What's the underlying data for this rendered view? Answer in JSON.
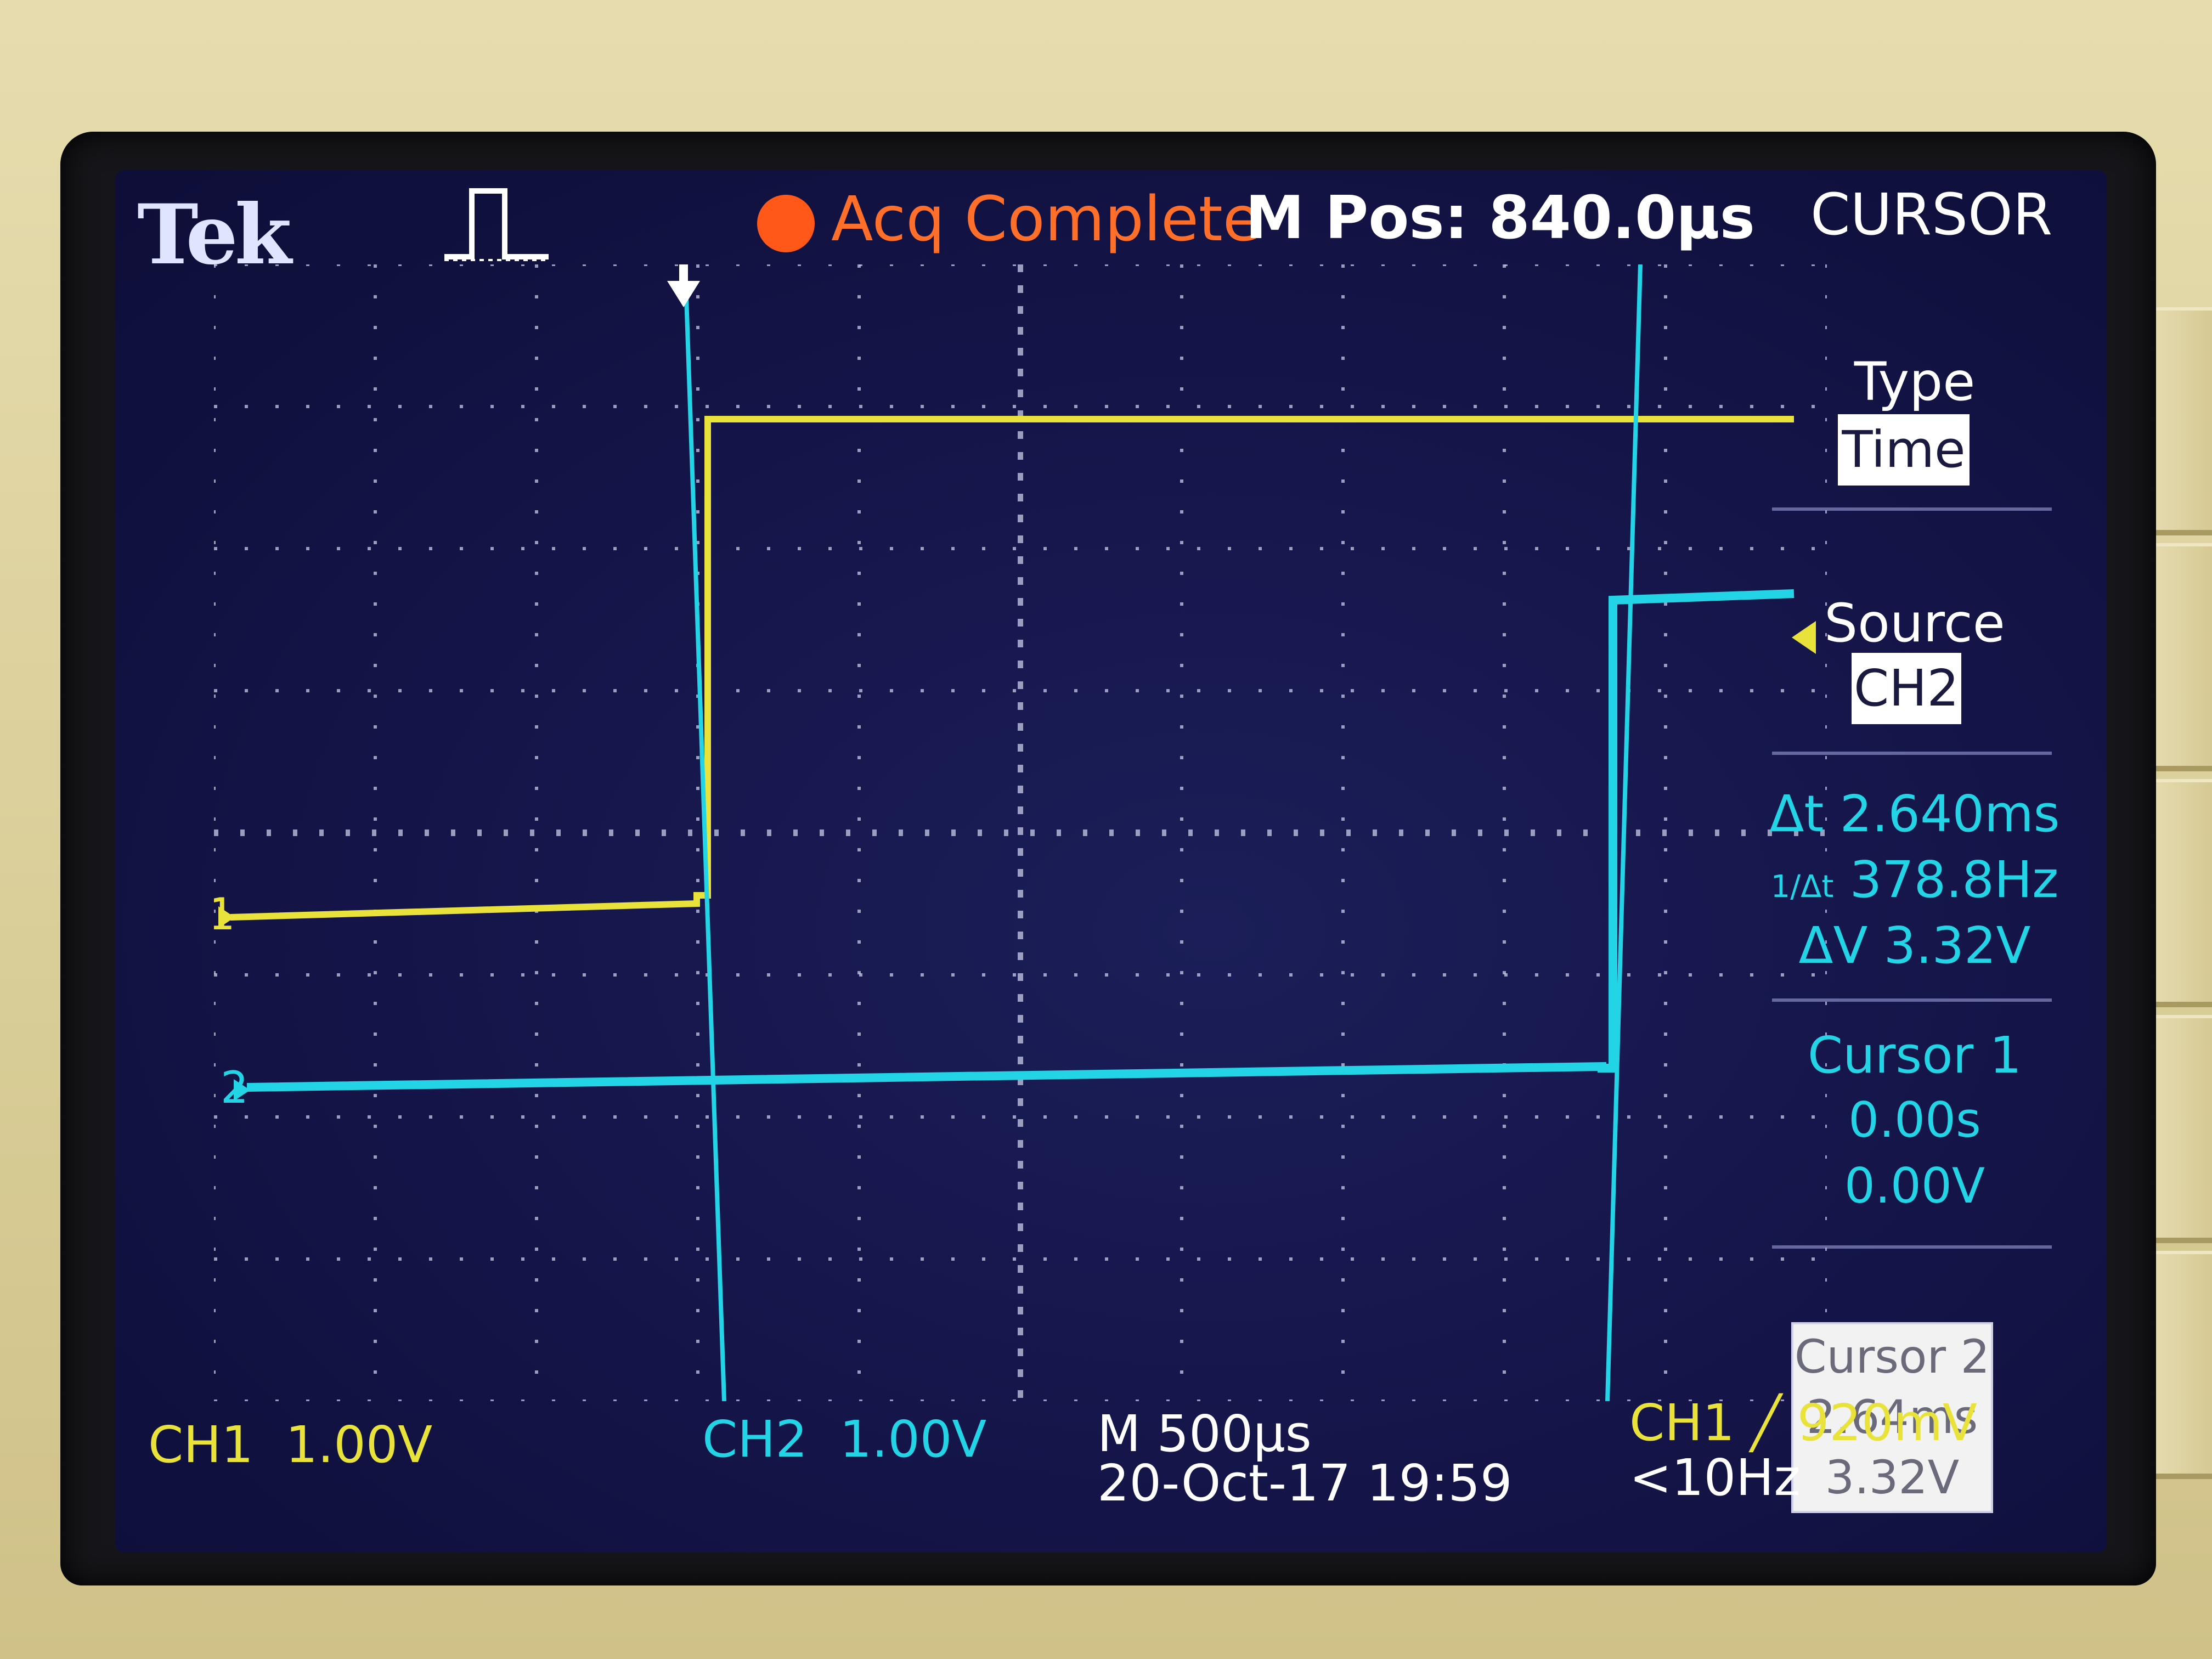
{
  "header": {
    "brand": "Tek",
    "acq_status": "Acq Complete",
    "mpos": "M Pos: 840.0µs",
    "menu_title": "CURSOR"
  },
  "menu": {
    "type_label": "Type",
    "type_value": "Time",
    "source_label": "Source",
    "source_value": "CH2",
    "delta_t": "Δt 2.640ms",
    "inv_delta_t": "378.8Hz",
    "inv_delta_t_symbol": "1/Δt",
    "delta_v": "ΔV 3.32V",
    "cursor1_label": "Cursor 1",
    "cursor1_time": "0.00s",
    "cursor1_volt": "0.00V",
    "cursor2_label": "Cursor 2",
    "cursor2_time": "2.64ms",
    "cursor2_volt": "3.32V"
  },
  "footer": {
    "ch1_name": "CH1",
    "ch1_scale": "1.00V",
    "ch2_name": "CH2",
    "ch2_scale": "1.00V",
    "timebase": "M 500µs",
    "datetime": "20-Oct-17 19:59",
    "trigger_setting": "CH1 ╱ 920mV",
    "trigger_freq": "<10Hz"
  },
  "markers": {
    "ch1": "1",
    "ch2": "2"
  },
  "colors": {
    "ch1": "#e8e23a",
    "ch2": "#22d4e6",
    "acq": "#ff6f2a",
    "screen": "#141448"
  },
  "traces": {
    "ch1_step_time_ms": 0.0,
    "ch2_step_time_ms": 2.64,
    "ch2_step_volts": 3.32
  }
}
